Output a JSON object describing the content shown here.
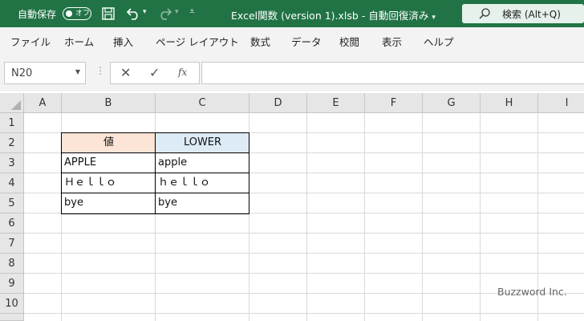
{
  "titlebar": {
    "autosave_label": "自動保存",
    "autosave_state": "オフ",
    "file_title": "Excel関数 (version 1).xlsb",
    "save_state": "自動回復済み",
    "search_label": "検索 (Alt+Q)",
    "bg_color": "#217346"
  },
  "menu": {
    "items": [
      "ファイル",
      "ホーム",
      "挿入",
      "ページ レイアウト",
      "数式",
      "データ",
      "校閲",
      "表示",
      "ヘルプ"
    ]
  },
  "formula_bar": {
    "name_box": "N20",
    "fx_label": "fx",
    "formula": ""
  },
  "grid": {
    "columns": [
      "A",
      "B",
      "C",
      "D",
      "E",
      "F",
      "G",
      "H",
      "I"
    ],
    "rows": [
      "1",
      "2",
      "3",
      "4",
      "5",
      "6",
      "7",
      "8",
      "9",
      "10"
    ]
  },
  "table": {
    "header_b": "値",
    "header_c": "LOWER",
    "rows": [
      {
        "b": "APPLE",
        "c": "apple"
      },
      {
        "b": "Ｈｅｌｌｏ",
        "c": "ｈｅｌｌｏ"
      },
      {
        "b": "bye",
        "c": "bye"
      }
    ],
    "header_b_color": "#fce4d6",
    "header_c_color": "#ddebf7"
  },
  "watermark": "Buzzword Inc."
}
